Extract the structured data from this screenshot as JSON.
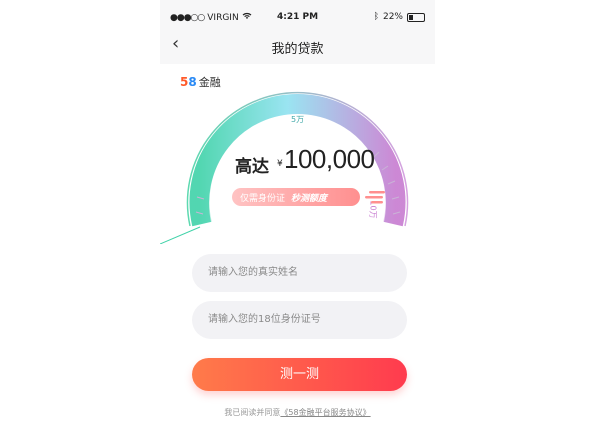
{
  "status_bar": {
    "carrier": "VIRGIN",
    "time": "4:21 PM",
    "battery": "22%"
  },
  "header": {
    "back_icon": "chevron-left-icon",
    "title": "我的贷款"
  },
  "logo": {
    "digit_a": "5",
    "digit_b": "8",
    "text": "金融"
  },
  "gauge": {
    "label_mid": "5万",
    "label_max": "10万"
  },
  "main": {
    "headline": "高达",
    "currency": "¥",
    "amount": "100,000",
    "pill_text": "仅需身份证",
    "pill_bold": "秒测额度"
  },
  "form": {
    "name_placeholder": "请输入您的真实姓名",
    "id_placeholder": "请输入您的18位身份证号",
    "submit_label": "测一测"
  },
  "agreement": {
    "prefix": "我已阅读并同意",
    "link": "《58金融平台服务协议》"
  },
  "colors": {
    "primary": "#ff4a4a",
    "gauge_start": "#3fd2a8",
    "gauge_end": "#c77bd0"
  }
}
